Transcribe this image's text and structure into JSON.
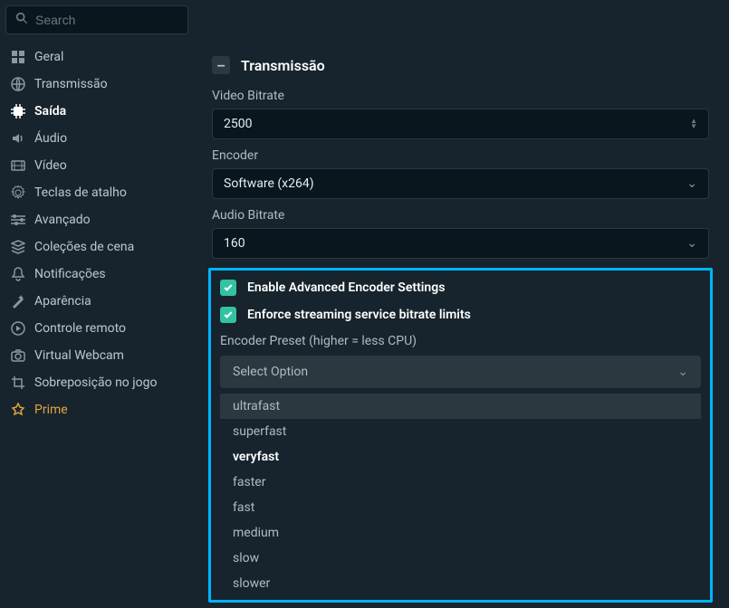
{
  "search": {
    "placeholder": "Search"
  },
  "sidebar": {
    "items": [
      {
        "label": "Geral"
      },
      {
        "label": "Transmissão"
      },
      {
        "label": "Saída"
      },
      {
        "label": "Áudio"
      },
      {
        "label": "Vídeo"
      },
      {
        "label": "Teclas de atalho"
      },
      {
        "label": "Avançado"
      },
      {
        "label": "Coleções de cena"
      },
      {
        "label": "Notificações"
      },
      {
        "label": "Aparência"
      },
      {
        "label": "Controle remoto"
      },
      {
        "label": "Virtual Webcam"
      },
      {
        "label": "Sobreposição no jogo"
      },
      {
        "label": "Prime"
      }
    ]
  },
  "section": {
    "title": "Transmissão",
    "video_bitrate_label": "Video Bitrate",
    "video_bitrate_value": "2500",
    "encoder_label": "Encoder",
    "encoder_value": "Software (x264)",
    "audio_bitrate_label": "Audio Bitrate",
    "audio_bitrate_value": "160"
  },
  "advanced": {
    "enable_label": "Enable Advanced Encoder Settings",
    "enforce_label": "Enforce streaming service bitrate limits",
    "preset_label": "Encoder Preset (higher = less CPU)",
    "preset_placeholder": "Select Option",
    "options": [
      "ultrafast",
      "superfast",
      "veryfast",
      "faster",
      "fast",
      "medium",
      "slow",
      "slower"
    ]
  }
}
